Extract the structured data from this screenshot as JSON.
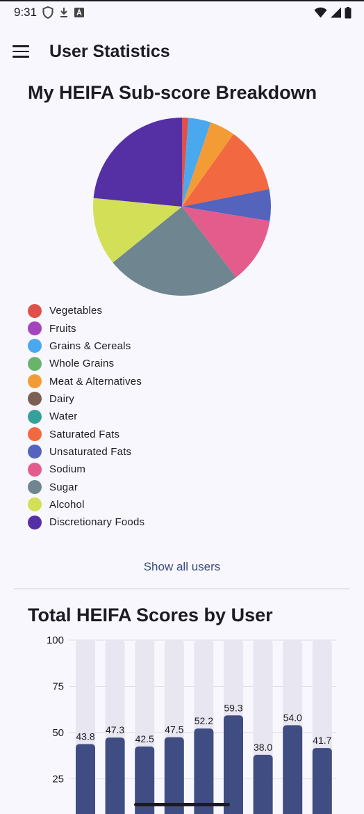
{
  "status_bar": {
    "time": "9:31",
    "left_icons": [
      "shield-icon",
      "download-icon",
      "app-icon"
    ],
    "right_icons": [
      "wifi-icon",
      "signal-icon",
      "battery-icon"
    ]
  },
  "app_bar": {
    "title": "User Statistics",
    "menu_icon": "hamburger-menu-icon"
  },
  "pie_section": {
    "title": "My HEIFA Sub-score Breakdown"
  },
  "show_all_label": "Show all users",
  "bar_section": {
    "title": "Total HEIFA Scores by User"
  },
  "chart_data": [
    {
      "type": "pie",
      "title": "My HEIFA Sub-score Breakdown",
      "legend_position": "bottom-left",
      "slices": [
        {
          "label": "Vegetables",
          "value": 1.0,
          "color": "#e0504a"
        },
        {
          "label": "Fruits",
          "value": 0.0,
          "color": "#a445be"
        },
        {
          "label": "Grains & Cereals",
          "value": 3.6,
          "color": "#4aa8ef"
        },
        {
          "label": "Whole Grains",
          "value": 0.0,
          "color": "#6ab36a"
        },
        {
          "label": "Meat & Alternatives",
          "value": 4.0,
          "color": "#f39c35"
        },
        {
          "label": "Dairy",
          "value": 0.0,
          "color": "#7b5f55"
        },
        {
          "label": "Water",
          "value": 0.0,
          "color": "#35a19a"
        },
        {
          "label": "Saturated Fats",
          "value": 10.5,
          "color": "#f26840"
        },
        {
          "label": "Unsaturated Fats",
          "value": 5.0,
          "color": "#5463bc"
        },
        {
          "label": "Sodium",
          "value": 10.5,
          "color": "#e35c8c"
        },
        {
          "label": "Sugar",
          "value": 21.5,
          "color": "#6f8590"
        },
        {
          "label": "Alcohol",
          "value": 10.8,
          "color": "#d3df57"
        },
        {
          "label": "Discretionary Foods",
          "value": 20.5,
          "color": "#5530a4"
        }
      ]
    },
    {
      "type": "bar",
      "title": "Total HEIFA Scores by User",
      "categories": [
        "",
        "",
        "",
        "",
        "",
        "",
        "",
        "",
        ""
      ],
      "values": [
        43.8,
        47.3,
        42.5,
        47.5,
        52.2,
        59.3,
        38.0,
        54.0,
        41.7
      ],
      "value_labels": [
        "43.8",
        "47.3",
        "42.5",
        "47.5",
        "52.2",
        "59.3",
        "38.0",
        "54.0",
        "41.7"
      ],
      "yticks": [
        "100",
        "75",
        "50",
        "25"
      ],
      "ylim": [
        0,
        100
      ],
      "grid": true,
      "bar_color": "#3f4d82",
      "track_color": "#e8e6f0"
    }
  ]
}
